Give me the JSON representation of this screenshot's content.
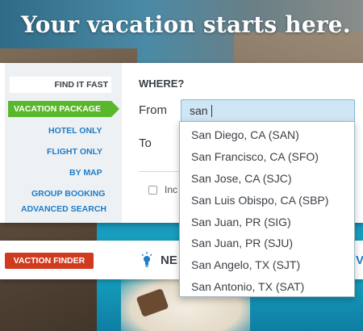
{
  "headline": "Your vacation starts here.",
  "sidebar": {
    "find_fast": "FIND IT FAST",
    "items": [
      {
        "label": "VACATION PACKAGE"
      },
      {
        "label": "HOTEL ONLY"
      },
      {
        "label": "FLIGHT ONLY"
      },
      {
        "label": "BY MAP"
      },
      {
        "label": "GROUP BOOKING"
      },
      {
        "label": "ADVANCED SEARCH"
      }
    ]
  },
  "form": {
    "where_label": "WHERE?",
    "from_label": "From",
    "to_label": "To",
    "from_value": "san",
    "checkbox_label": "Inc"
  },
  "autocomplete": [
    "San Diego, CA (SAN)",
    "San Francisco, CA (SFO)",
    "San Jose, CA (SJC)",
    "San Luis Obispo, CA (SBP)",
    "San Juan, PR (SIG)",
    "San Juan, PR (SJU)",
    "San Angelo, TX (SJT)",
    "San Antonio, TX (SAT)"
  ],
  "finder": {
    "tab_label": "VACTION FINDER",
    "partial_title": "NE",
    "partial_link": "V"
  },
  "colors": {
    "active_tab": "#58b72a",
    "finder_tab": "#d03a1f",
    "link_blue": "#1e7cc8",
    "input_bg": "#cfe6f4"
  }
}
